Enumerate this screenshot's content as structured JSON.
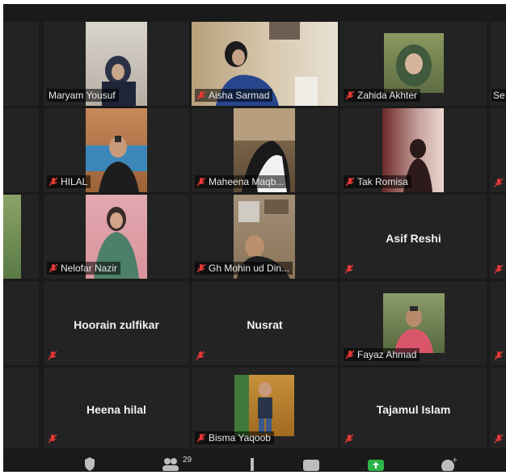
{
  "participants": {
    "maryam": {
      "name": "Maryam Yousuf"
    },
    "aisha": {
      "name": "Aisha Sarmad"
    },
    "zahida": {
      "name": "Zahida Akhter"
    },
    "partial": {
      "name": "Se"
    },
    "hilal": {
      "name": "HILAL"
    },
    "maheena": {
      "name": "Maheena Maqb..."
    },
    "tak": {
      "name": "Tak Romisa"
    },
    "nelofar": {
      "name": "Nelofar Nazir"
    },
    "mohin": {
      "name": "Gh Mohin ud Din..."
    },
    "asif": {
      "name": "Asif Reshi"
    },
    "hoorain": {
      "name": "Hoorain zulfikar"
    },
    "nusrat": {
      "name": "Nusrat"
    },
    "fayaz": {
      "name": "Fayaz Ahmad"
    },
    "heena": {
      "name": "Heena hilal"
    },
    "bisma": {
      "name": "Bisma Yaqoob"
    },
    "tajamul": {
      "name": "Tajamul Islam"
    }
  },
  "toolbar": {
    "participants_count": "29"
  },
  "colors": {
    "muted_mic": "#e53935",
    "tile_bg": "#232323",
    "share_green": "#2eb34a"
  },
  "icons": [
    "muted-mic-icon",
    "security-icon",
    "participants-icon",
    "chat-icon",
    "share-screen-icon",
    "reactions-icon"
  ]
}
